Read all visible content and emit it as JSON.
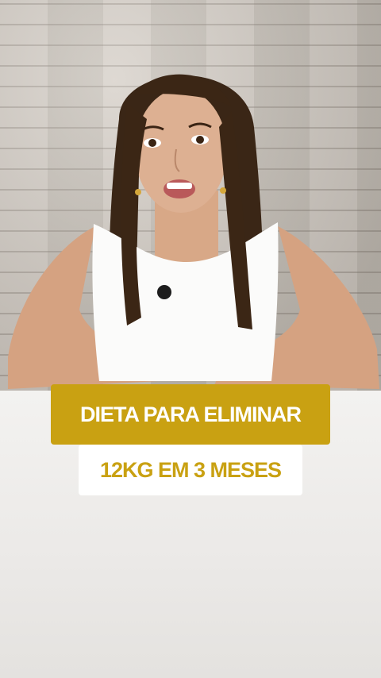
{
  "captions": {
    "line1": "DIETA PARA ELIMINAR",
    "line2": "12KG EM 3 MESES"
  },
  "colors": {
    "accent": "#c9a112",
    "caption_bg_secondary": "#ffffff",
    "table": "#eeecea"
  }
}
